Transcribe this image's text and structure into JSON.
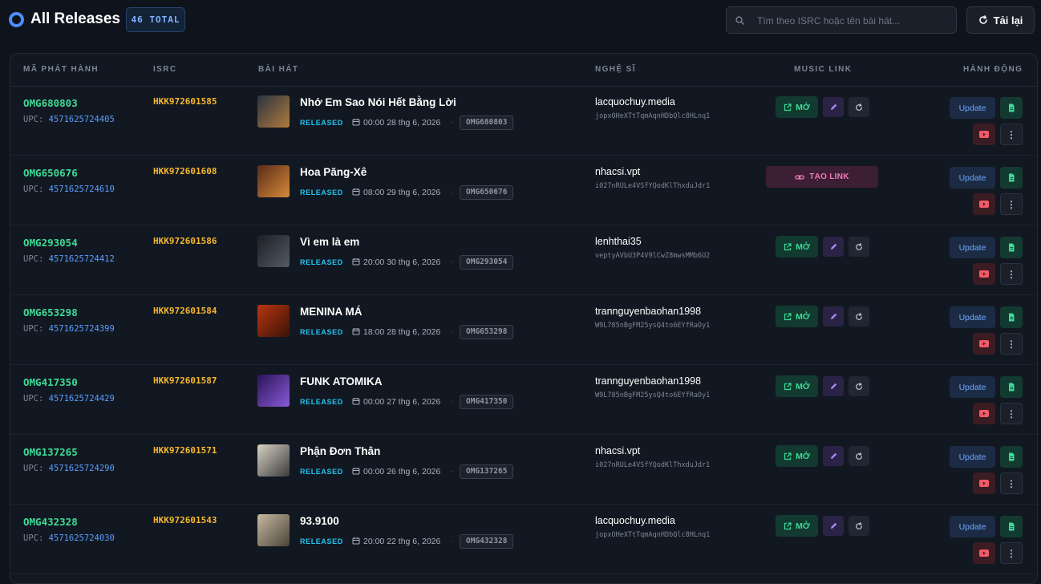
{
  "header": {
    "title": "All Releases",
    "total_badge": "46 TOTAL",
    "search_placeholder": "Tìm theo ISRC hoặc tên bài hát...",
    "reload_label": "Tải lại"
  },
  "columns": {
    "release_code": "MÃ PHÁT HÀNH",
    "isrc": "ISRC",
    "song": "BÀI HÁT",
    "artist": "NGHỆ SĨ",
    "music_link": "MUSIC LINK",
    "actions": "HÀNH ĐỘNG"
  },
  "labels": {
    "upc_prefix": "UPC:",
    "open": "MỞ",
    "create_link": "TẠO LINK",
    "update": "Update",
    "more": "⋮",
    "dot": "·"
  },
  "colors": {
    "accent_green": "#3ddc97",
    "accent_yellow": "#f5b731",
    "accent_blue": "#5b9dff",
    "accent_cyan": "#22c3ee",
    "accent_pink": "#f07ab7",
    "accent_purple": "#a78bfa",
    "accent_red": "#f05a6a"
  },
  "rows": [
    {
      "id": "OMG680803",
      "upc": "4571625724405",
      "isrc": "HKK972601585",
      "title": "Nhớ Em Sao Nói Hết Bằng Lời",
      "status": "RELEASED",
      "date": "00:00 28 thg 6, 2026",
      "code": "OMG680803",
      "artist": "lacquochuy.media",
      "artist_id": "jopxOHeXTtTqmAqnHDbQlc8HLnq1",
      "link_state": "open",
      "art": [
        "#2a3342",
        "#b07a3c"
      ]
    },
    {
      "id": "OMG650676",
      "upc": "4571625724610",
      "isrc": "HKK972601608",
      "title": "Hoa Păng-Xê",
      "status": "RELEASED",
      "date": "08:00 29 thg 6, 2026",
      "code": "OMG650676",
      "artist": "nhacsi.vpt",
      "artist_id": "i027nRULe4VSfYQodKlThxduJdr1",
      "link_state": "create",
      "art": [
        "#5a2b18",
        "#d58a3a"
      ]
    },
    {
      "id": "OMG293054",
      "upc": "4571625724412",
      "isrc": "HKK972601586",
      "title": "Vì em là em",
      "status": "RELEASED",
      "date": "20:00 30 thg 6, 2026",
      "code": "OMG293054",
      "artist": "lenhthai35",
      "artist_id": "veptyAVbU3P4V9lCwZ8mwsMMb6U2",
      "link_state": "open",
      "art": [
        "#1b1e24",
        "#555a63"
      ]
    },
    {
      "id": "OMG653298",
      "upc": "4571625724399",
      "isrc": "HKK972601584",
      "title": "MENINA MÁ",
      "status": "RELEASED",
      "date": "18:00 28 thg 6, 2026",
      "code": "OMG653298",
      "artist": "trannguyenbaohan1998",
      "artist_id": "W9L785nBgFM25ysQ4to6EYfRaOy1",
      "link_state": "open",
      "art": [
        "#b8360f",
        "#3a1208"
      ]
    },
    {
      "id": "OMG417350",
      "upc": "4571625724429",
      "isrc": "HKK972601587",
      "title": "FUNK ATOMIKA",
      "status": "RELEASED",
      "date": "00:00 27 thg 6, 2026",
      "code": "OMG417350",
      "artist": "trannguyenbaohan1998",
      "artist_id": "W9L785nBgFM25ysQ4to6EYfRaOy1",
      "link_state": "open",
      "art": [
        "#2a1458",
        "#8a5ad8"
      ]
    },
    {
      "id": "OMG137265",
      "upc": "4571625724290",
      "isrc": "HKK972601571",
      "title": "Phận Đơn Thân",
      "status": "RELEASED",
      "date": "00:00 26 thg 6, 2026",
      "code": "OMG137265",
      "artist": "nhacsi.vpt",
      "artist_id": "i027nRULe4VSfYQodKlThxduJdr1",
      "link_state": "open",
      "art": [
        "#d9d2c2",
        "#3a3b3e"
      ]
    },
    {
      "id": "OMG432328",
      "upc": "4571625724030",
      "isrc": "HKK972601543",
      "title": "93.9100",
      "status": "RELEASED",
      "date": "20:00 22 thg 6, 2026",
      "code": "OMG432328",
      "artist": "lacquochuy.media",
      "artist_id": "jopxOHeXTtTqmAqnHDbQlc8HLnq1",
      "link_state": "open",
      "art": [
        "#c7b9a0",
        "#4a4438"
      ]
    }
  ]
}
